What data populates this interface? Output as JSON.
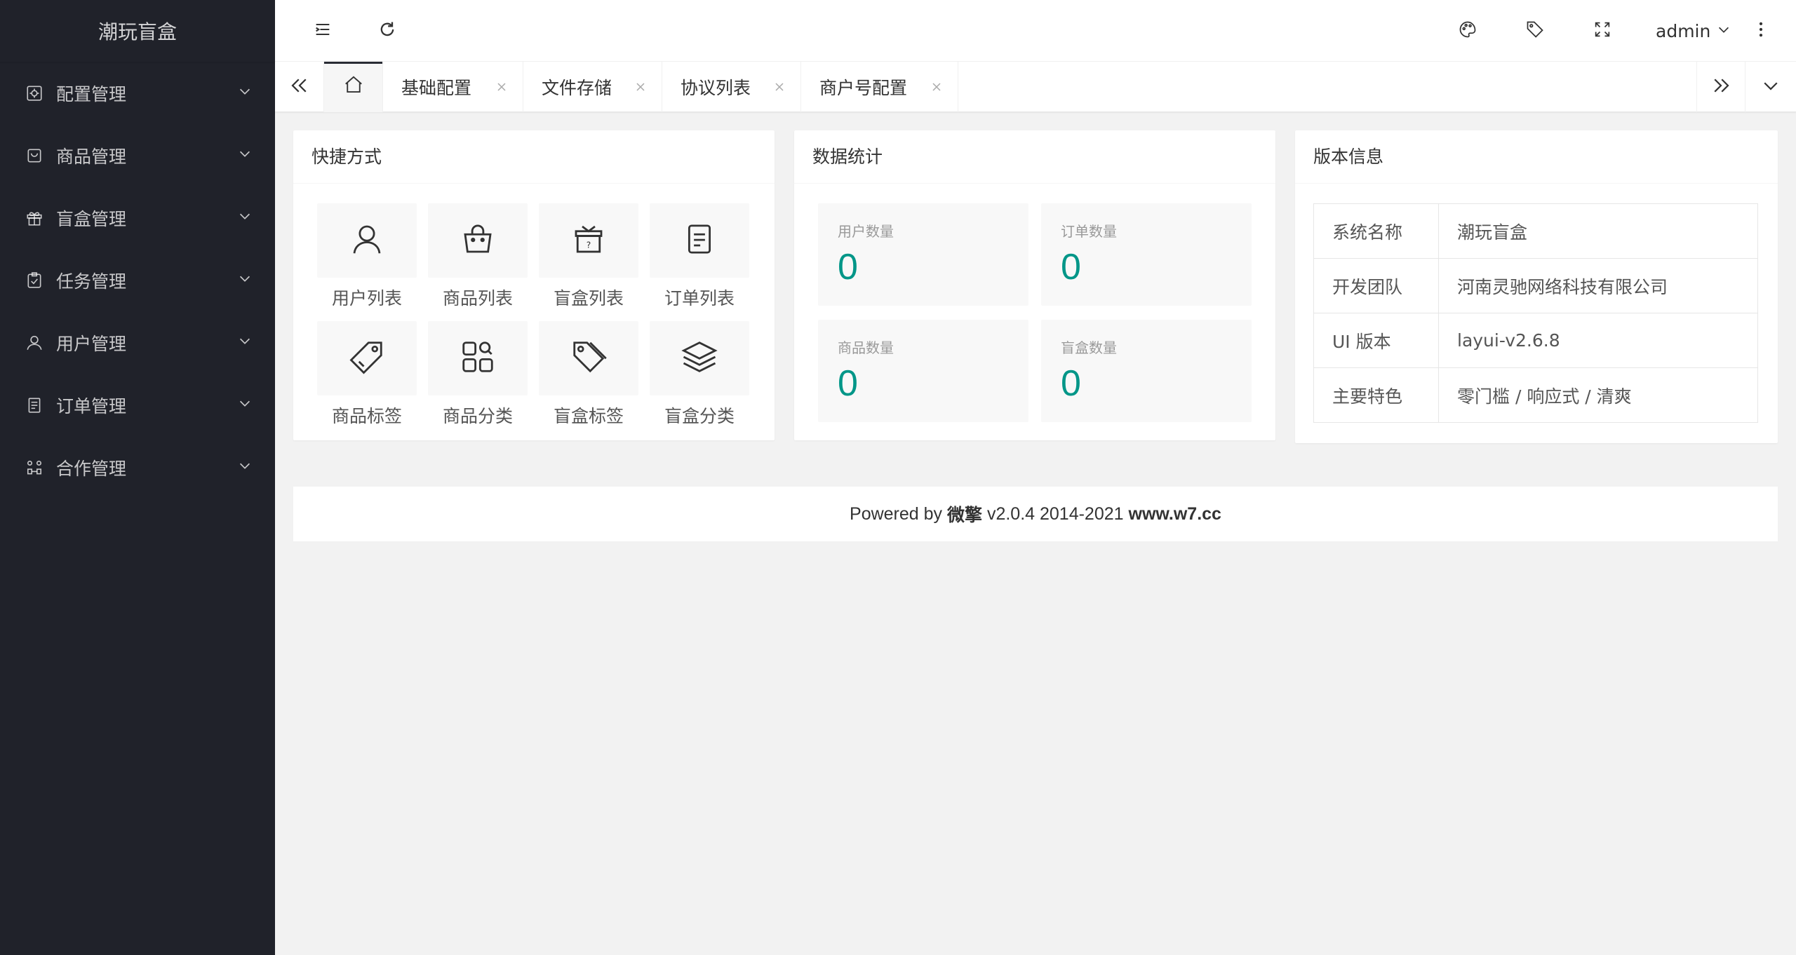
{
  "app": {
    "logo": "潮玩盲盒"
  },
  "sidebar": {
    "items": [
      {
        "label": "配置管理",
        "icon": "settings-icon"
      },
      {
        "label": "商品管理",
        "icon": "shopping-bag-icon"
      },
      {
        "label": "盲盒管理",
        "icon": "gift-icon"
      },
      {
        "label": "任务管理",
        "icon": "clipboard-check-icon"
      },
      {
        "label": "用户管理",
        "icon": "user-icon"
      },
      {
        "label": "订单管理",
        "icon": "document-icon"
      },
      {
        "label": "合作管理",
        "icon": "network-icon"
      }
    ]
  },
  "header": {
    "user": "admin"
  },
  "tabs": [
    {
      "label": "基础配置"
    },
    {
      "label": "文件存储"
    },
    {
      "label": "协议列表"
    },
    {
      "label": "商户号配置"
    }
  ],
  "shortcuts": {
    "title": "快捷方式",
    "items": [
      {
        "label": "用户列表",
        "icon": "user-icon"
      },
      {
        "label": "商品列表",
        "icon": "shopping-bag-icon"
      },
      {
        "label": "盲盒列表",
        "icon": "mystery-box-icon"
      },
      {
        "label": "订单列表",
        "icon": "document-icon"
      },
      {
        "label": "商品标签",
        "icon": "tag-icon"
      },
      {
        "label": "商品分类",
        "icon": "category-icon"
      },
      {
        "label": "盲盒标签",
        "icon": "tags-icon"
      },
      {
        "label": "盲盒分类",
        "icon": "layers-icon"
      }
    ]
  },
  "stats": {
    "title": "数据统计",
    "items": [
      {
        "label": "用户数量",
        "value": "0"
      },
      {
        "label": "订单数量",
        "value": "0"
      },
      {
        "label": "商品数量",
        "value": "0"
      },
      {
        "label": "盲盒数量",
        "value": "0"
      }
    ]
  },
  "version": {
    "title": "版本信息",
    "rows": [
      {
        "key": "系统名称",
        "value": "潮玩盲盒"
      },
      {
        "key": "开发团队",
        "value": "河南灵驰网络科技有限公司"
      },
      {
        "key": "UI 版本",
        "value": "layui-v2.6.8"
      },
      {
        "key": "主要特色",
        "value": "零门槛 / 响应式 / 清爽"
      }
    ]
  },
  "footer": {
    "prefix": "Powered by ",
    "brand": "微擎",
    "middle": " v2.0.4 2014-2021 ",
    "site": "www.w7.cc"
  },
  "colors": {
    "sidebar_bg": "#20222a",
    "accent": "#009688",
    "page_bg": "#f2f2f2"
  }
}
